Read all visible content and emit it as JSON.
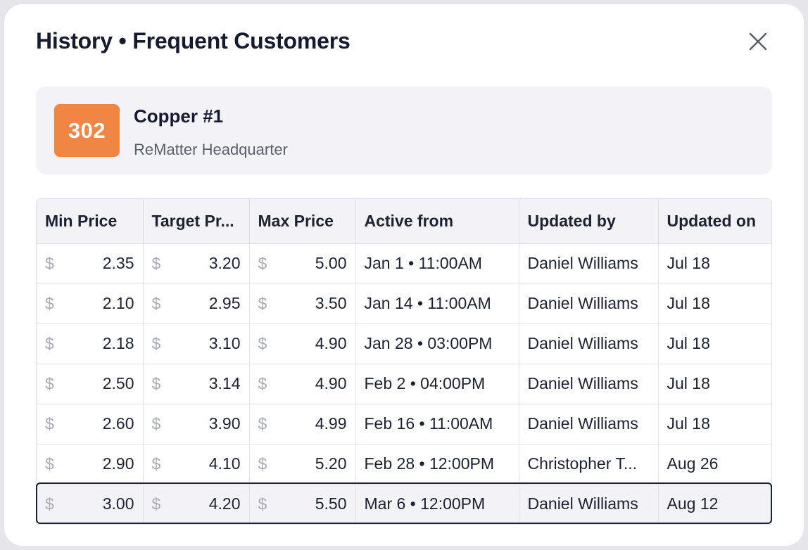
{
  "dialog": {
    "title": "History • Frequent Customers",
    "close_icon": "close-icon"
  },
  "item": {
    "code": "302",
    "name": "Copper #1",
    "location": "ReMatter Headquarter",
    "badge_color": "#f08544"
  },
  "table": {
    "currency_symbol": "$",
    "headers": [
      "Min Price",
      "Target Pr...",
      "Max Price",
      "Active from",
      "Updated by",
      "Updated on"
    ],
    "rows": [
      {
        "min": "2.35",
        "target": "3.20",
        "max": "5.00",
        "active_from": "Jan 1 • 11:00AM",
        "updated_by": "Daniel Williams",
        "updated_on": "Jul 18"
      },
      {
        "min": "2.10",
        "target": "2.95",
        "max": "3.50",
        "active_from": "Jan 14 • 11:00AM",
        "updated_by": "Daniel Williams",
        "updated_on": "Jul 18"
      },
      {
        "min": "2.18",
        "target": "3.10",
        "max": "4.90",
        "active_from": "Jan 28 • 03:00PM",
        "updated_by": "Daniel Williams",
        "updated_on": "Jul 18"
      },
      {
        "min": "2.50",
        "target": "3.14",
        "max": "4.90",
        "active_from": "Feb 2 • 04:00PM",
        "updated_by": "Daniel Williams",
        "updated_on": "Jul 18"
      },
      {
        "min": "2.60",
        "target": "3.90",
        "max": "4.99",
        "active_from": "Feb 16 • 11:00AM",
        "updated_by": "Daniel Williams",
        "updated_on": "Jul 18"
      },
      {
        "min": "2.90",
        "target": "4.10",
        "max": "5.20",
        "active_from": "Feb 28 • 12:00PM",
        "updated_by": "Christopher T...",
        "updated_on": "Aug 26"
      },
      {
        "min": "3.00",
        "target": "4.20",
        "max": "5.50",
        "active_from": "Mar 6 • 12:00PM",
        "updated_by": "Daniel Williams",
        "updated_on": "Aug 12"
      }
    ],
    "selected_row": 6
  }
}
